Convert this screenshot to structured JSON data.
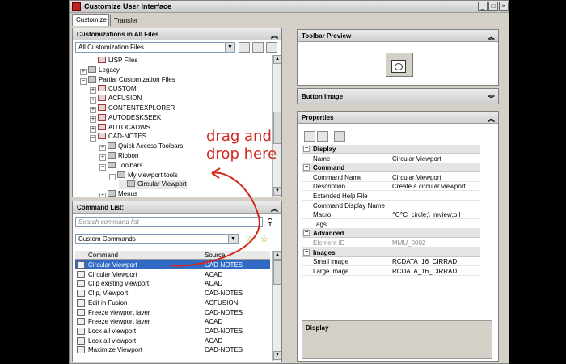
{
  "window": {
    "title": "Customize User Interface",
    "controls": [
      "_",
      "□",
      "×"
    ]
  },
  "tabs": [
    {
      "label": "Customize"
    },
    {
      "label": "Transfer"
    }
  ],
  "customizations": {
    "header": "Customizations in All Files",
    "combo": "All Customization Files",
    "tree": [
      {
        "label": "LISP Files",
        "indent": 1,
        "exp": ""
      },
      {
        "label": "Legacy",
        "indent": 0,
        "exp": "+"
      },
      {
        "label": "Partial Customization Files",
        "indent": 0,
        "exp": "−"
      },
      {
        "label": "CUSTOM",
        "indent": 1,
        "exp": "+"
      },
      {
        "label": "ACFUSION",
        "indent": 1,
        "exp": "+"
      },
      {
        "label": "CONTENTEXPLORER",
        "indent": 1,
        "exp": "+"
      },
      {
        "label": "AUTODESKSEEK",
        "indent": 1,
        "exp": "+"
      },
      {
        "label": "AUTOCADWS",
        "indent": 1,
        "exp": "+"
      },
      {
        "label": "CAD-NOTES",
        "indent": 1,
        "exp": "−"
      },
      {
        "label": "Quick Access Toolbars",
        "indent": 2,
        "exp": "+"
      },
      {
        "label": "Ribbon",
        "indent": 2,
        "exp": "+"
      },
      {
        "label": "Toolbars",
        "indent": 2,
        "exp": "−"
      },
      {
        "label": "My viewport tools",
        "indent": 3,
        "exp": "−"
      },
      {
        "label": "Circular Viewport",
        "indent": 4,
        "exp": ""
      },
      {
        "label": "Menus",
        "indent": 2,
        "exp": "+"
      }
    ]
  },
  "commands": {
    "header": "Command List:",
    "search_placeholder": "Search command list",
    "filter": "Custom Commands",
    "columns": {
      "command": "Command",
      "source": "Source"
    },
    "rows": [
      {
        "name": "Circular Viewport",
        "source": "CAD-NOTES"
      },
      {
        "name": "Circular Viewport",
        "source": "ACAD"
      },
      {
        "name": "Clip existing viewport",
        "source": "ACAD"
      },
      {
        "name": "Clip, Viewport",
        "source": "CAD-NOTES"
      },
      {
        "name": "Edit in Fusion",
        "source": "ACFUSION"
      },
      {
        "name": "Freeze viewport layer",
        "source": "CAD-NOTES"
      },
      {
        "name": "Freeze viewport layer",
        "source": "ACAD"
      },
      {
        "name": "Lock all viewport",
        "source": "CAD-NOTES"
      },
      {
        "name": "Lock all viewport",
        "source": "ACAD"
      },
      {
        "name": "Maximize Viewport",
        "source": "CAD-NOTES"
      }
    ]
  },
  "toolbar_preview": {
    "header": "Toolbar Preview"
  },
  "button_image": {
    "header": "Button Image"
  },
  "properties": {
    "header": "Properties",
    "rows": [
      {
        "type": "cat",
        "label": "Display"
      },
      {
        "type": "prop",
        "name": "Name",
        "value": "Circular Viewport"
      },
      {
        "type": "cat",
        "label": "Command"
      },
      {
        "type": "prop",
        "name": "Command Name",
        "value": "Circular Viewport"
      },
      {
        "type": "prop",
        "name": "Description",
        "value": "Create a circular viewport"
      },
      {
        "type": "prop",
        "name": "Extended Help File",
        "value": ""
      },
      {
        "type": "prop",
        "name": "Command Display Name",
        "value": ""
      },
      {
        "type": "prop",
        "name": "Macro",
        "value": "^C^C_circle;\\_mview;o;l"
      },
      {
        "type": "prop",
        "name": "Tags",
        "value": ""
      },
      {
        "type": "cat",
        "label": "Advanced"
      },
      {
        "type": "prop",
        "name": "Element ID",
        "value": "MMU_0002",
        "gray": true
      },
      {
        "type": "cat",
        "label": "Images"
      },
      {
        "type": "prop",
        "name": "Small image",
        "value": "RCDATA_16_CIRRAD"
      },
      {
        "type": "prop",
        "name": "Large image",
        "value": "RCDATA_16_CIRRAD"
      }
    ],
    "description_title": "Display"
  },
  "annotation": {
    "line1": "drag and",
    "line2": "drop here"
  },
  "colors": {
    "accent": "#316ac5",
    "annotation": "#d0281e"
  }
}
